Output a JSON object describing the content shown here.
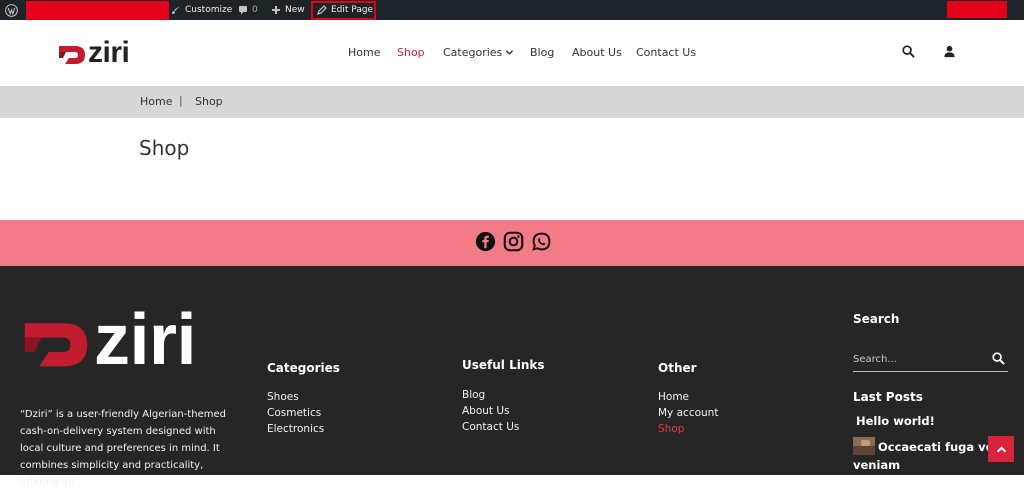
{
  "admin_bar": {
    "customize_label": "Customize",
    "comments_count": "0",
    "new_label": "New",
    "edit_page_label": "Edit Page"
  },
  "header": {
    "logo_text": "ziri",
    "nav": [
      {
        "label": "Home"
      },
      {
        "label": "Shop",
        "active": true
      },
      {
        "label": "Categories"
      },
      {
        "label": "Blog"
      },
      {
        "label": "About Us"
      },
      {
        "label": "Contact Us"
      }
    ]
  },
  "breadcrumb": {
    "home": "Home",
    "separator": "|",
    "current": "Shop"
  },
  "page": {
    "title": "Shop"
  },
  "social": {
    "icons": [
      "facebook-icon",
      "instagram-icon",
      "whatsapp-icon"
    ]
  },
  "footer": {
    "logo_text": "ziri",
    "about_text": "“Dziri” is a user-friendly Algerian-themed cash-on-delivery system designed with local culture and preferences in mind. It combines simplicity and practicality, offering an",
    "categories": {
      "heading": "Categories",
      "links": [
        "Shoes",
        "Cosmetics",
        "Electronics"
      ]
    },
    "useful_links": {
      "heading": "Useful Links",
      "links": [
        "Blog",
        "About Us",
        "Contact Us"
      ]
    },
    "other": {
      "heading": "Other",
      "links": [
        "Home",
        "My account",
        "Shop"
      ]
    },
    "search": {
      "heading": "Search",
      "placeholder": "Search..."
    },
    "last_posts": {
      "heading": "Last Posts",
      "posts": [
        "Hello world!",
        "Occaecati fuga volupt",
        "veniam"
      ]
    }
  },
  "colors": {
    "admin_bar": "#1d2327",
    "accent_red": "#d7243a",
    "social_bar": "#f27b87",
    "footer_bg": "#262626",
    "breadcrumb_bg": "#d7d7d7"
  }
}
